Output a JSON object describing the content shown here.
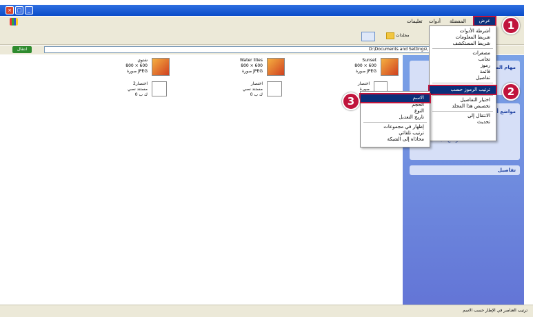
{
  "window": {
    "close_label": "×",
    "restore_label": "□",
    "min_label": "_"
  },
  "menubar": {
    "view": "عرض",
    "favorites": "المفضلة",
    "tools": "أدوات",
    "help": "تعليمات"
  },
  "toolbar": {
    "folders_label": "مجلدات"
  },
  "address": {
    "path": "D:\\Documents and Settings\\",
    "go_label": "انتقال"
  },
  "files": [
    {
      "name": "Sunset",
      "dims": "800 × 600",
      "type": "صورة JPEG"
    },
    {
      "name": "Water lilies",
      "dims": "800 × 600",
      "type": "صورة JPEG"
    },
    {
      "name": "شتوي",
      "dims": "800 × 600",
      "type": "صورة JPEG"
    },
    {
      "name": "اختصار",
      "dims": "",
      "type": "صورة"
    },
    {
      "name": "اختصار",
      "dims": "مستند نصي",
      "type": "0 ك ب"
    },
    {
      "name": "اختصار2",
      "dims": "مستند نصي",
      "type": "0 ك ب"
    }
  ],
  "view_menu": {
    "items": [
      "أشرطة الأدوات",
      "شريط المعلومات",
      "شريط المستكشف",
      "مصغرات",
      "تجانب",
      "رموز",
      "قائمة",
      "تفاصيل",
      "ترتيب الرموز حسب",
      "اختيار التفاصيل",
      "تخصيص هذا المجلد",
      "الانتقال إلى",
      "تحديث"
    ]
  },
  "arrange_menu": {
    "items": [
      "الاسم",
      "الحجم",
      "النوع",
      "تاريخ التعديل",
      "إظهار في مجموعات",
      "ترتيب تلقائي",
      "محاذاة إلى الشبكة"
    ]
  },
  "taskpane": {
    "tasks_title": "مهام الصور",
    "places_title": "مواضع أخرى",
    "places": [
      "المستندات",
      "المستندات المشتركة",
      "جهاز الكمبيوتر",
      "مواضع شبكة الاتصال"
    ],
    "details_title": "تفاصيل"
  },
  "status": {
    "text": "ترتيب العناصر في الإطار حسب الاسم"
  },
  "callouts": [
    "1",
    "2",
    "3"
  ]
}
